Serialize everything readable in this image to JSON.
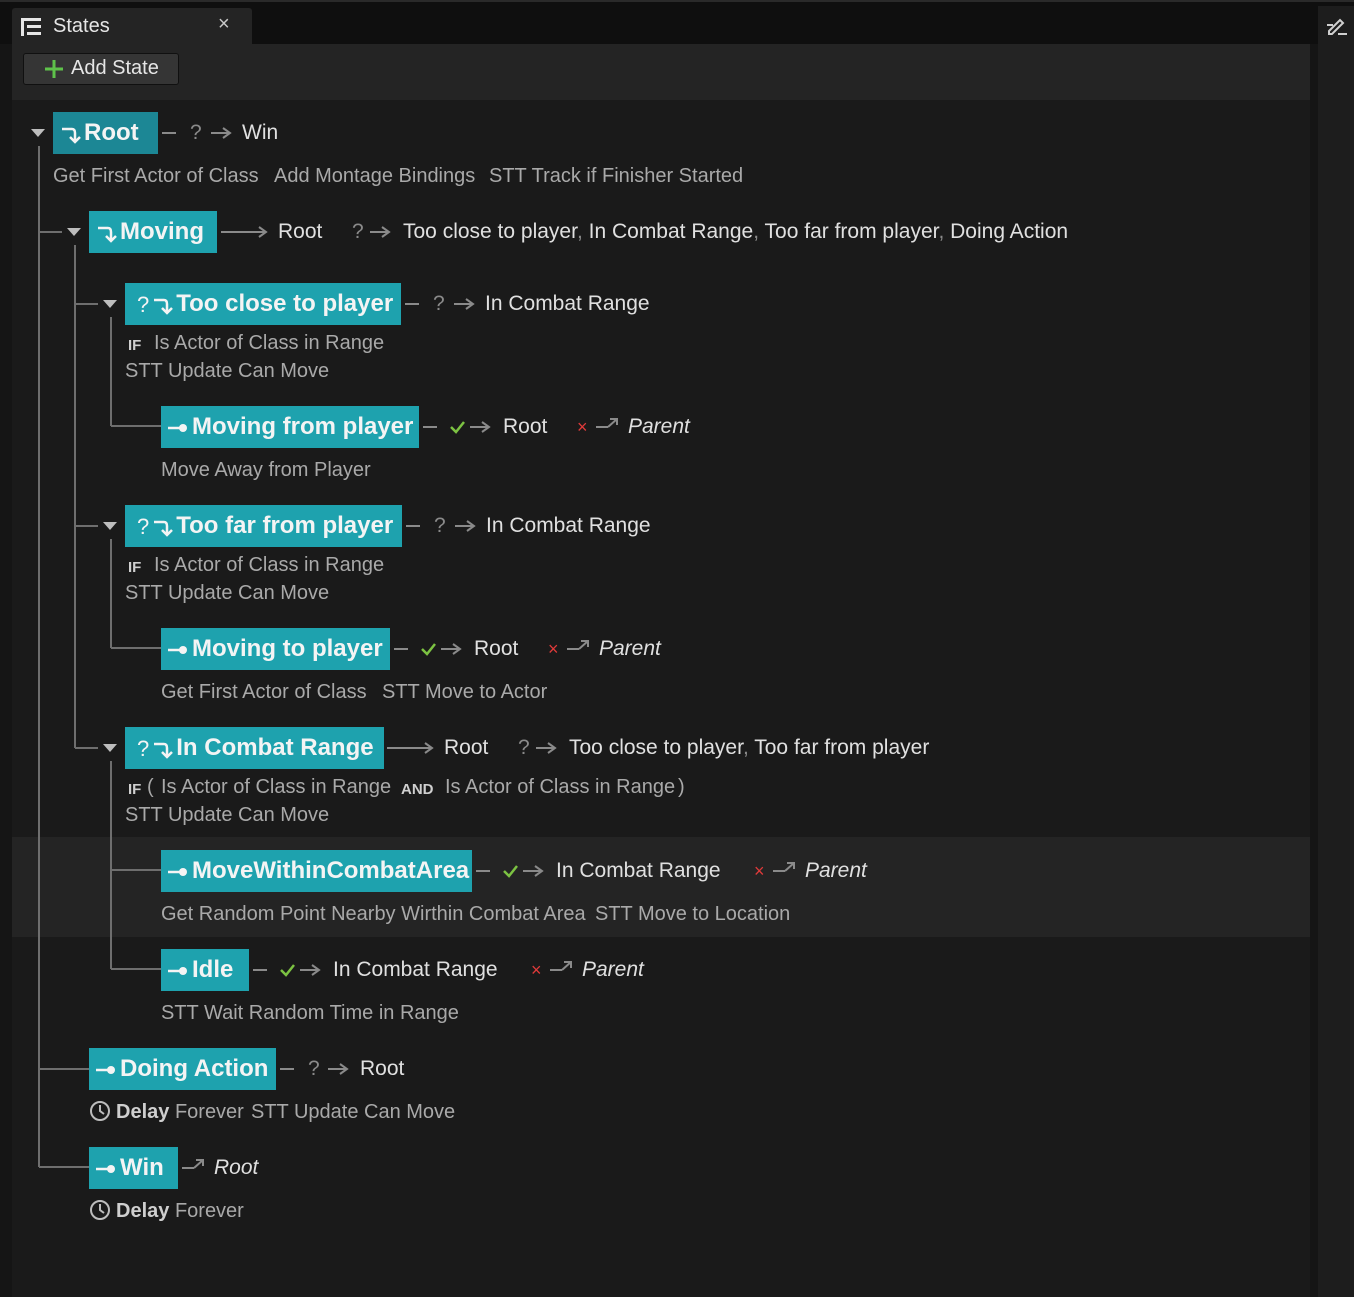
{
  "tab": {
    "title": "States",
    "close": "×"
  },
  "toolbar": {
    "add_state": "Add State"
  },
  "symbols": {
    "question": "?",
    "comma": ",",
    "x": "×"
  },
  "states": {
    "root": {
      "name": "Root",
      "next": "Win",
      "tasks": [
        "Get First Actor of Class",
        "Add Montage Bindings",
        "STT Track if Finisher Started"
      ]
    },
    "moving": {
      "name": "Moving",
      "next": "Root",
      "cond_targets": [
        "Too close to player",
        "In Combat Range",
        "Too far from player",
        "Doing Action"
      ]
    },
    "too_close": {
      "name": "Too close to player",
      "next": "In Combat Range",
      "if_label": "IF",
      "condition": "Is Actor of Class in Range",
      "task": "STT Update Can Move"
    },
    "moving_from": {
      "name": "Moving from player",
      "success": "Root",
      "fail": "Parent",
      "task": "Move Away from Player"
    },
    "too_far": {
      "name": "Too far from player",
      "next": "In Combat Range",
      "if_label": "IF",
      "condition": "Is Actor of Class in Range",
      "task": "STT Update Can Move"
    },
    "moving_to": {
      "name": "Moving to player",
      "success": "Root",
      "fail": "Parent",
      "tasks": [
        "Get First Actor of Class",
        "STT Move to Actor"
      ]
    },
    "in_combat": {
      "name": "In Combat Range",
      "next": "Root",
      "cond_targets": [
        "Too close to player",
        "Too far from player"
      ],
      "if_label": "IF",
      "open_paren": "(",
      "cond1": "Is Actor of Class in Range",
      "and_label": "AND",
      "cond2": "Is Actor of Class in Range",
      "close_paren": ")",
      "task": "STT Update Can Move"
    },
    "move_within": {
      "name": "MoveWithinCombatArea",
      "success": "In Combat Range",
      "fail": "Parent",
      "tasks": [
        "Get Random Point Nearby Wirthin Combat Area",
        "STT Move to Location"
      ]
    },
    "idle": {
      "name": "Idle",
      "success": "In Combat Range",
      "fail": "Parent",
      "task": "STT Wait Random Time in Range"
    },
    "doing_action": {
      "name": "Doing Action",
      "next": "Root",
      "delay_label": "Delay",
      "delay_value": "Forever",
      "task": "STT Update Can Move"
    },
    "win": {
      "name": "Win",
      "next": "Root",
      "delay_label": "Delay",
      "delay_value": "Forever"
    }
  },
  "colors": {
    "state": "#1ea2ae",
    "root_state": "#1c8795",
    "success": "#7cc242",
    "fail": "#e03a3a",
    "add_icon": "#5ec24a"
  }
}
